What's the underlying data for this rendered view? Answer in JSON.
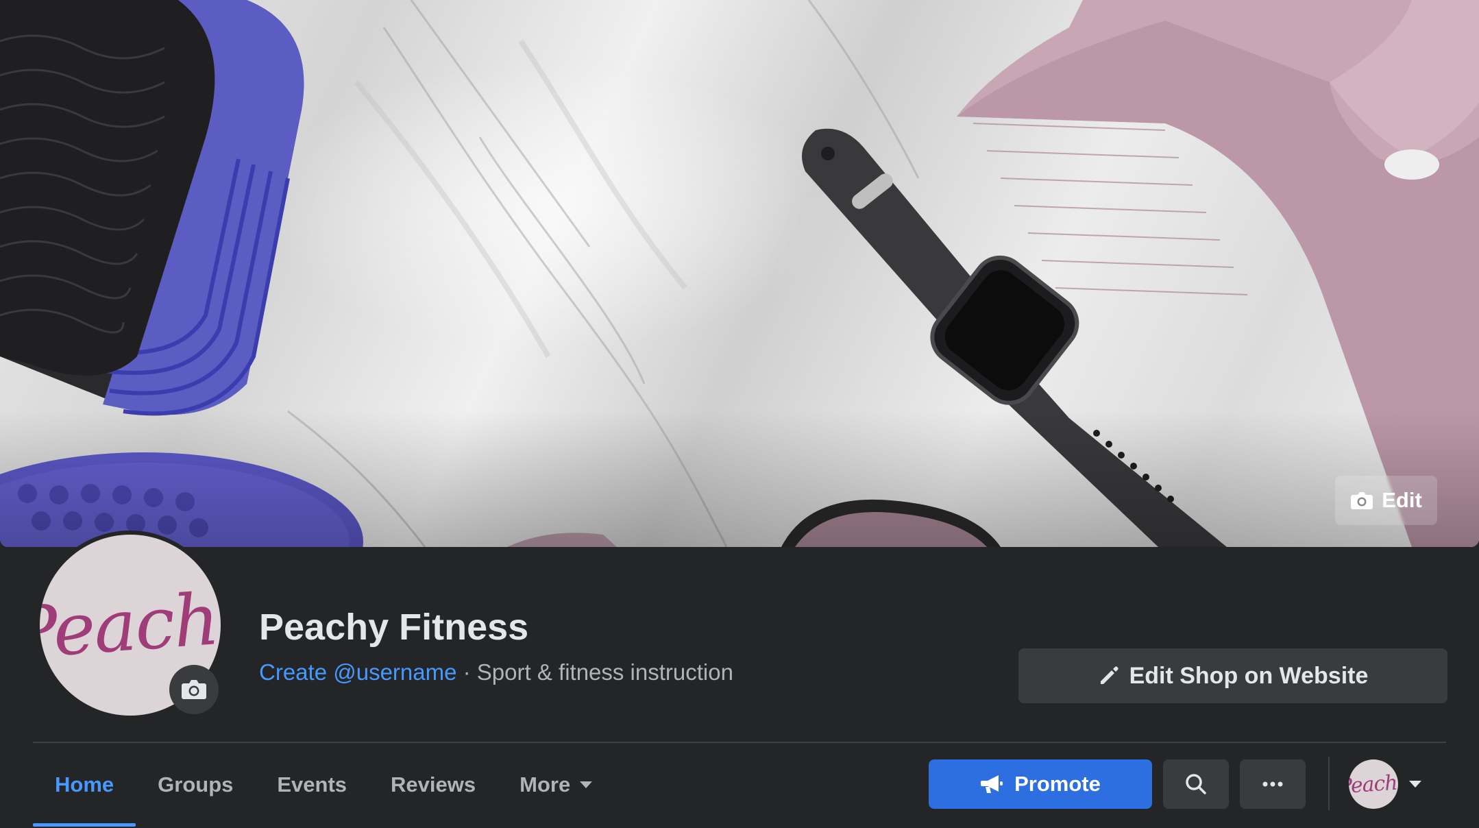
{
  "cover": {
    "edit_label": "Edit"
  },
  "profile": {
    "avatar_text": "Peachy",
    "name": "Peachy Fitness",
    "username_link": "Create @username",
    "separator": " · ",
    "category": "Sport & fitness instruction"
  },
  "actions": {
    "edit_shop_label": "Edit Shop on Website",
    "promote_label": "Promote",
    "account_avatar_text": "Peachy"
  },
  "tabs": [
    {
      "label": "Home",
      "active": true
    },
    {
      "label": "Groups"
    },
    {
      "label": "Events"
    },
    {
      "label": "Reviews"
    },
    {
      "label": "More"
    }
  ],
  "colors": {
    "background": "#242526",
    "accent": "#4599ff",
    "promote": "#2d6ee0",
    "button": "#3a3b3c",
    "avatar_bg": "#ddd4d8",
    "brand": "#9e3d78"
  }
}
